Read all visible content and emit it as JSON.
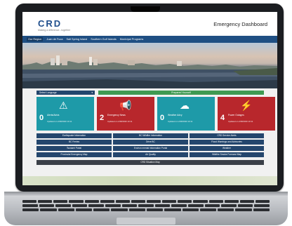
{
  "header": {
    "logo_text": "CRD",
    "logo_subtitle": "Making a difference...together",
    "title": "Emergency Dashboard"
  },
  "nav": {
    "items": [
      "Our Region",
      "Juan de Fuca",
      "Salt Spring Island",
      "Southern Gulf Islands",
      "Municipal Programs"
    ]
  },
  "toolbar": {
    "language_label": "Select Language",
    "prepared_label": "Prepared Yourself"
  },
  "tiles": [
    {
      "count": "0",
      "name": "Alerts/Advis",
      "updated": "Updated on 2/28/2020 10:11",
      "icon": "warning-icon",
      "color": "#1e9aa8"
    },
    {
      "count": "2",
      "name": "Emergency News",
      "updated": "Updated on 2/28/2020 10:11",
      "icon": "megaphone-icon",
      "color": "#b8272c"
    },
    {
      "count": "0",
      "name": "Weather Advy",
      "updated": "Updated on 2/28/2020 10:11",
      "icon": "cloud-icon",
      "color": "#1e9aa8"
    },
    {
      "count": "4",
      "name": "Power Outages",
      "updated": "Updated on 2/28/2020 10:11",
      "icon": "lightning-icon",
      "color": "#b8272c"
    }
  ],
  "buttons": [
    [
      "Earthquake Information",
      "BC Wildfire Information",
      "CRD Service Alerts"
    ],
    [
      "BC Ferries",
      "Drive BC",
      "Flood Warnings and Advisories"
    ],
    [
      "Tsunami Portal",
      "Environ mental Information Portal",
      "Weather"
    ],
    [
      "Provincial Emergency Map",
      "Air Quality",
      "Wildfire Smoke Forecast Map"
    ]
  ],
  "map_button": "CRD Situation Map"
}
